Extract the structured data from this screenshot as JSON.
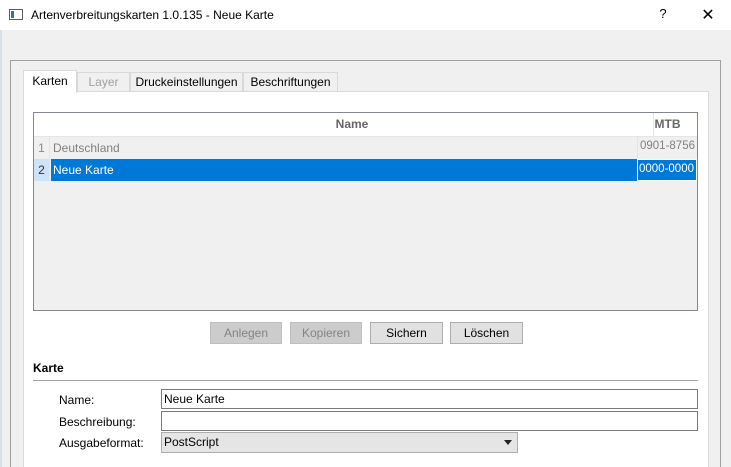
{
  "window": {
    "title": "Artenverbreitungskarten 1.0.135 - Neue Karte",
    "help_label": "?",
    "close_label": "✕"
  },
  "tabs": [
    {
      "label": "Karten",
      "state": "active"
    },
    {
      "label": "Layer",
      "state": "disabled"
    },
    {
      "label": "Druckeinstellungen",
      "state": "normal"
    },
    {
      "label": "Beschriftungen",
      "state": "normal"
    }
  ],
  "table": {
    "columns": [
      "Name",
      "MTB"
    ],
    "rows": [
      {
        "num": "1",
        "name": "Deutschland",
        "mtb": "0901-8756",
        "selected": false
      },
      {
        "num": "2",
        "name": "Neue Karte",
        "mtb": "0000-0000",
        "selected": true
      }
    ],
    "selection_color": "#0078d7"
  },
  "buttons": {
    "anlegen": "Anlegen",
    "kopieren": "Kopieren",
    "sichern": "Sichern",
    "loeschen": "Löschen"
  },
  "karte": {
    "section_title": "Karte",
    "name_label": "Name:",
    "name_value": "Neue Karte",
    "beschreibung_label": "Beschreibung:",
    "beschreibung_value": "",
    "ausgabeformat_label": "Ausgabeformat:",
    "ausgabeformat_value": "PostScript"
  },
  "icons": {
    "app": "app-window-icon",
    "dropdown": "chevron-down-icon"
  }
}
